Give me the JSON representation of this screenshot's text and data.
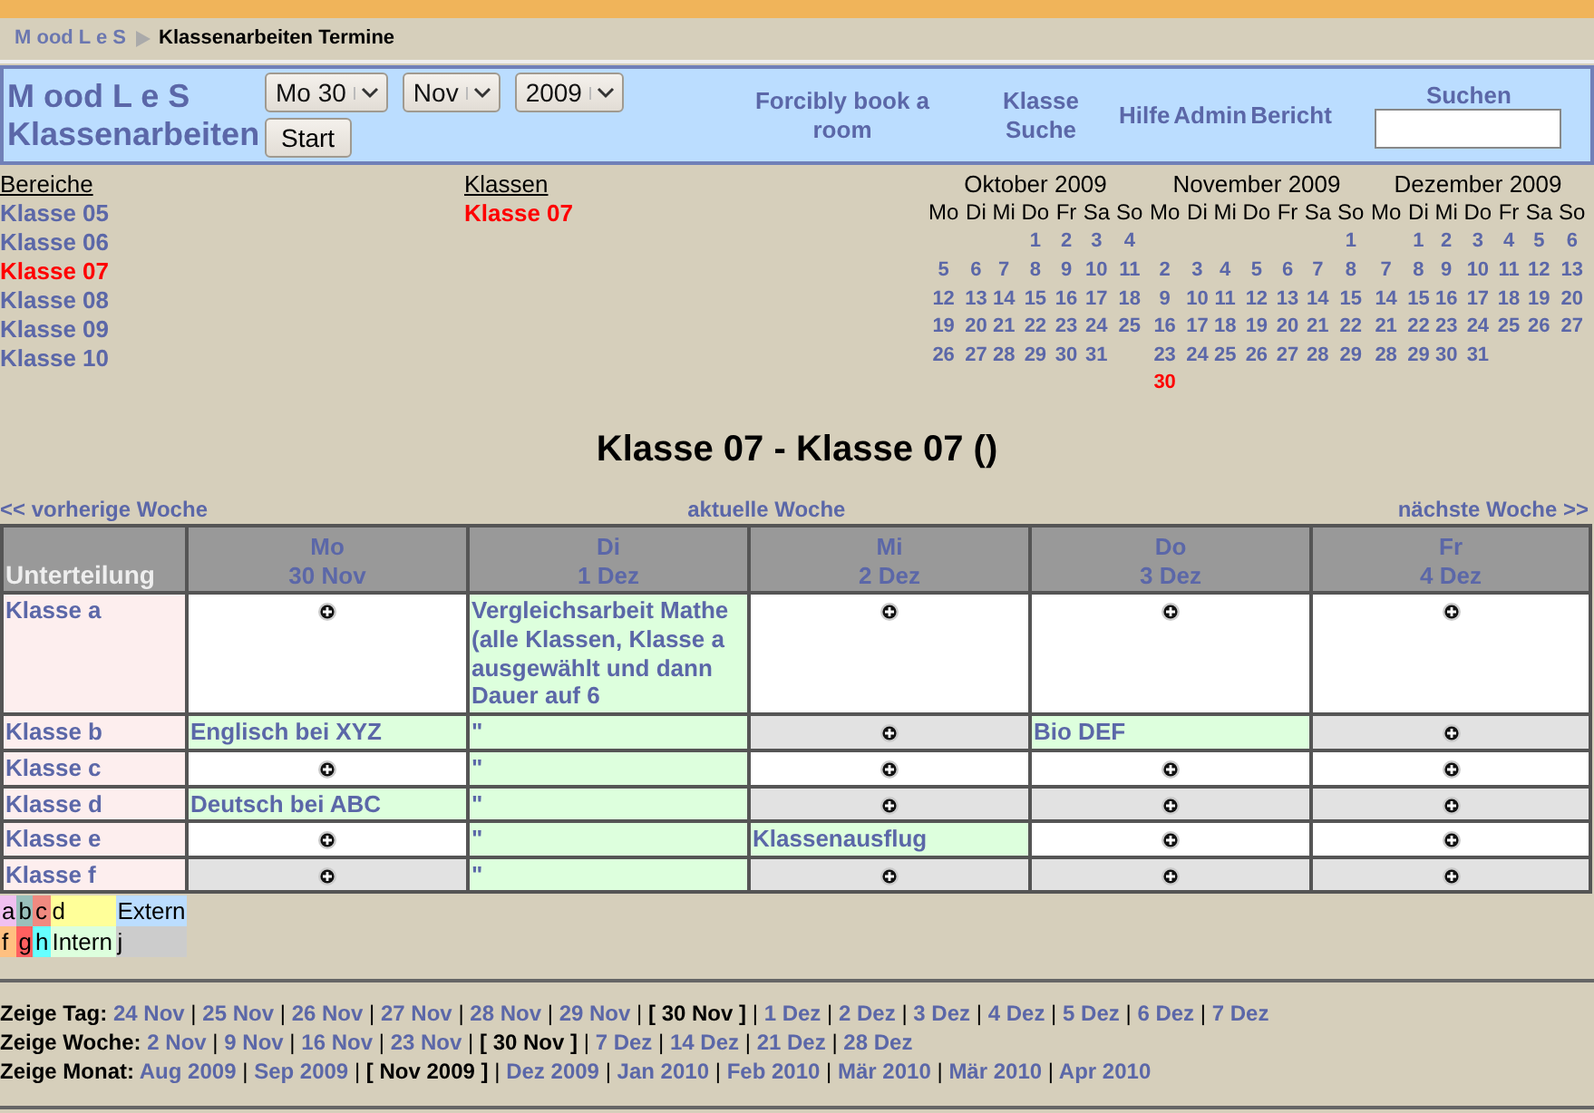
{
  "breadcrumb": {
    "home": "M ood L e S",
    "current": "Klassenarbeiten Termine"
  },
  "header": {
    "title": [
      "M ood L e S",
      "Klassenarbeiten"
    ],
    "selects": [
      "Mo 30",
      "Nov",
      "2009"
    ],
    "start_button": "Start",
    "links": [
      {
        "label": "Forcibly book a room",
        "kind": "wide"
      },
      {
        "label": "Klasse Suche",
        "kind": "wide"
      },
      {
        "label": "Hilfe",
        "kind": "narrow"
      },
      {
        "label": "Admin",
        "kind": "narrow"
      },
      {
        "label": "Bericht",
        "kind": "narrow"
      }
    ],
    "search": {
      "label": "Suchen"
    }
  },
  "bereiche": {
    "heading": "Bereiche",
    "items": [
      {
        "label": "Klasse 05",
        "selected": false
      },
      {
        "label": "Klasse 06",
        "selected": false
      },
      {
        "label": "Klasse 07",
        "selected": true
      },
      {
        "label": "Klasse 08",
        "selected": false
      },
      {
        "label": "Klasse 09",
        "selected": false
      },
      {
        "label": "Klasse 10",
        "selected": false
      }
    ]
  },
  "klassen": {
    "heading": "Klassen",
    "items": [
      {
        "label": "Klasse 07",
        "selected": true
      }
    ]
  },
  "calendars": [
    {
      "title": "Oktober 2009",
      "weekdays": [
        "Mo",
        "Di",
        "Mi",
        "Do",
        "Fr",
        "Sa",
        "So"
      ],
      "weeks": [
        {
          "kind": "opening",
          "days": [
            {
              "d": "1",
              "selected": false
            },
            {
              "d": "2",
              "selected": false
            },
            {
              "d": "3",
              "selected": false
            },
            {
              "d": "4",
              "selected": false
            }
          ]
        },
        {
          "kind": "full",
          "days": [
            {
              "d": "5",
              "selected": false
            },
            {
              "d": "6",
              "selected": false
            },
            {
              "d": "7",
              "selected": false
            },
            {
              "d": "8",
              "selected": false
            },
            {
              "d": "9",
              "selected": false
            },
            {
              "d": "10",
              "selected": false
            },
            {
              "d": "11",
              "selected": false
            }
          ]
        },
        {
          "kind": "full",
          "days": [
            {
              "d": "12",
              "selected": false
            },
            {
              "d": "13",
              "selected": false
            },
            {
              "d": "14",
              "selected": false
            },
            {
              "d": "15",
              "selected": false
            },
            {
              "d": "16",
              "selected": false
            },
            {
              "d": "17",
              "selected": false
            },
            {
              "d": "18",
              "selected": false
            }
          ]
        },
        {
          "kind": "full",
          "days": [
            {
              "d": "19",
              "selected": false
            },
            {
              "d": "20",
              "selected": false
            },
            {
              "d": "21",
              "selected": false
            },
            {
              "d": "22",
              "selected": false
            },
            {
              "d": "23",
              "selected": false
            },
            {
              "d": "24",
              "selected": false
            },
            {
              "d": "25",
              "selected": false
            }
          ]
        },
        {
          "kind": "closing",
          "days": [
            {
              "d": "26",
              "selected": false
            },
            {
              "d": "27",
              "selected": false
            },
            {
              "d": "28",
              "selected": false
            },
            {
              "d": "29",
              "selected": false
            },
            {
              "d": "30",
              "selected": false
            },
            {
              "d": "31",
              "selected": false
            }
          ]
        }
      ]
    },
    {
      "title": "November 2009",
      "weekdays": [
        "Mo",
        "Di",
        "Mi",
        "Do",
        "Fr",
        "Sa",
        "So"
      ],
      "weeks": [
        {
          "kind": "opening",
          "days": [
            {
              "d": "1",
              "selected": false
            }
          ]
        },
        {
          "kind": "full",
          "days": [
            {
              "d": "2",
              "selected": false
            },
            {
              "d": "3",
              "selected": false
            },
            {
              "d": "4",
              "selected": false
            },
            {
              "d": "5",
              "selected": false
            },
            {
              "d": "6",
              "selected": false
            },
            {
              "d": "7",
              "selected": false
            },
            {
              "d": "8",
              "selected": false
            }
          ]
        },
        {
          "kind": "full",
          "days": [
            {
              "d": "9",
              "selected": false
            },
            {
              "d": "10",
              "selected": false
            },
            {
              "d": "11",
              "selected": false
            },
            {
              "d": "12",
              "selected": false
            },
            {
              "d": "13",
              "selected": false
            },
            {
              "d": "14",
              "selected": false
            },
            {
              "d": "15",
              "selected": false
            }
          ]
        },
        {
          "kind": "full",
          "days": [
            {
              "d": "16",
              "selected": false
            },
            {
              "d": "17",
              "selected": false
            },
            {
              "d": "18",
              "selected": false
            },
            {
              "d": "19",
              "selected": false
            },
            {
              "d": "20",
              "selected": false
            },
            {
              "d": "21",
              "selected": false
            },
            {
              "d": "22",
              "selected": false
            }
          ]
        },
        {
          "kind": "full",
          "days": [
            {
              "d": "23",
              "selected": false
            },
            {
              "d": "24",
              "selected": false
            },
            {
              "d": "25",
              "selected": false
            },
            {
              "d": "26",
              "selected": false
            },
            {
              "d": "27",
              "selected": false
            },
            {
              "d": "28",
              "selected": false
            },
            {
              "d": "29",
              "selected": false
            }
          ]
        },
        {
          "kind": "closing",
          "days": [
            {
              "d": "30",
              "selected": true
            }
          ]
        }
      ]
    },
    {
      "title": "Dezember 2009",
      "weekdays": [
        "Mo",
        "Di",
        "Mi",
        "Do",
        "Fr",
        "Sa",
        "So"
      ],
      "weeks": [
        {
          "kind": "opening",
          "days": [
            {
              "d": "1",
              "selected": false
            },
            {
              "d": "2",
              "selected": false
            },
            {
              "d": "3",
              "selected": false
            },
            {
              "d": "4",
              "selected": false
            },
            {
              "d": "5",
              "selected": false
            },
            {
              "d": "6",
              "selected": false
            }
          ]
        },
        {
          "kind": "full",
          "days": [
            {
              "d": "7",
              "selected": false
            },
            {
              "d": "8",
              "selected": false
            },
            {
              "d": "9",
              "selected": false
            },
            {
              "d": "10",
              "selected": false
            },
            {
              "d": "11",
              "selected": false
            },
            {
              "d": "12",
              "selected": false
            },
            {
              "d": "13",
              "selected": false
            }
          ]
        },
        {
          "kind": "full",
          "days": [
            {
              "d": "14",
              "selected": false
            },
            {
              "d": "15",
              "selected": false
            },
            {
              "d": "16",
              "selected": false
            },
            {
              "d": "17",
              "selected": false
            },
            {
              "d": "18",
              "selected": false
            },
            {
              "d": "19",
              "selected": false
            },
            {
              "d": "20",
              "selected": false
            }
          ]
        },
        {
          "kind": "full",
          "days": [
            {
              "d": "21",
              "selected": false
            },
            {
              "d": "22",
              "selected": false
            },
            {
              "d": "23",
              "selected": false
            },
            {
              "d": "24",
              "selected": false
            },
            {
              "d": "25",
              "selected": false
            },
            {
              "d": "26",
              "selected": false
            },
            {
              "d": "27",
              "selected": false
            }
          ]
        },
        {
          "kind": "closing",
          "days": [
            {
              "d": "28",
              "selected": false
            },
            {
              "d": "29",
              "selected": false
            },
            {
              "d": "30",
              "selected": false
            },
            {
              "d": "31",
              "selected": false
            }
          ]
        }
      ]
    }
  ],
  "page_title": "Klasse 07 - Klasse 07 ()",
  "week_nav": {
    "previous": "<< vorherige Woche",
    "current": "aktuelle Woche",
    "next": "nächste Woche >>"
  },
  "table": {
    "corner": "Unterteilung",
    "columns": [
      {
        "day": "Mo",
        "date": "30 Nov"
      },
      {
        "day": "Di",
        "date": "1 Dez"
      },
      {
        "day": "Mi",
        "date": "2 Dez"
      },
      {
        "day": "Do",
        "date": "3 Dez"
      },
      {
        "day": "Fr",
        "date": "4 Dez"
      }
    ],
    "rows": [
      {
        "label": "Klasse a",
        "shaded": false,
        "cells": [
          {
            "kind": "add"
          },
          {
            "kind": "entry",
            "text": "Vergleichsarbeit Mathe (alle Klassen, Klasse a ausgewählt und dann Dauer auf 6"
          },
          {
            "kind": "add"
          },
          {
            "kind": "add"
          },
          {
            "kind": "add"
          }
        ]
      },
      {
        "label": "Klasse b",
        "shaded": true,
        "cells": [
          {
            "kind": "entry",
            "text": "Englisch bei XYZ"
          },
          {
            "kind": "entry",
            "text": "\""
          },
          {
            "kind": "add"
          },
          {
            "kind": "entry",
            "text": "Bio DEF"
          },
          {
            "kind": "add"
          }
        ]
      },
      {
        "label": "Klasse c",
        "shaded": false,
        "cells": [
          {
            "kind": "add"
          },
          {
            "kind": "entry",
            "text": "\""
          },
          {
            "kind": "add"
          },
          {
            "kind": "add"
          },
          {
            "kind": "add"
          }
        ]
      },
      {
        "label": "Klasse d",
        "shaded": true,
        "cells": [
          {
            "kind": "entry",
            "text": "Deutsch bei ABC"
          },
          {
            "kind": "entry",
            "text": "\""
          },
          {
            "kind": "add"
          },
          {
            "kind": "add"
          },
          {
            "kind": "add"
          }
        ]
      },
      {
        "label": "Klasse e",
        "shaded": false,
        "cells": [
          {
            "kind": "add"
          },
          {
            "kind": "entry",
            "text": "\""
          },
          {
            "kind": "entry",
            "text": "Klassenausflug"
          },
          {
            "kind": "add"
          },
          {
            "kind": "add"
          }
        ]
      },
      {
        "label": "Klasse f",
        "shaded": true,
        "cells": [
          {
            "kind": "add"
          },
          {
            "kind": "entry",
            "text": "\""
          },
          {
            "kind": "add"
          },
          {
            "kind": "add"
          },
          {
            "kind": "add"
          }
        ]
      }
    ]
  },
  "legend": [
    [
      {
        "label": "a",
        "color": "#f0c0f0"
      },
      {
        "label": "b",
        "color": "#99c0bb"
      },
      {
        "label": "c",
        "color": "#f08a80"
      },
      {
        "label": "d",
        "color": "#ffff99"
      },
      {
        "label": "Extern",
        "color": "#bbddff"
      }
    ],
    [
      {
        "label": "f",
        "color": "#ffc080"
      },
      {
        "label": "g",
        "color": "#ff6060"
      },
      {
        "label": "h",
        "color": "#66ffff"
      },
      {
        "label": "Intern",
        "color": "#ddffdd"
      },
      {
        "label": "j",
        "color": "#cccccc"
      }
    ]
  ],
  "footer": [
    {
      "label": "Zeige Tag:",
      "separator": "|",
      "links": [
        {
          "label": "24 Nov",
          "selected": false
        },
        {
          "label": "25 Nov",
          "selected": false
        },
        {
          "label": "26 Nov",
          "selected": false
        },
        {
          "label": "27 Nov",
          "selected": false
        },
        {
          "label": "28 Nov",
          "selected": false
        },
        {
          "label": "29 Nov",
          "selected": false
        },
        {
          "label": "[ 30 Nov ]",
          "selected": true
        },
        {
          "label": "1 Dez",
          "selected": false
        },
        {
          "label": "2 Dez",
          "selected": false
        },
        {
          "label": "3 Dez",
          "selected": false
        },
        {
          "label": "4 Dez",
          "selected": false
        },
        {
          "label": "5 Dez",
          "selected": false
        },
        {
          "label": "6 Dez",
          "selected": false
        },
        {
          "label": "7 Dez",
          "selected": false
        }
      ]
    },
    {
      "label": "Zeige Woche:",
      "separator": "|",
      "links": [
        {
          "label": "2 Nov",
          "selected": false
        },
        {
          "label": "9 Nov",
          "selected": false
        },
        {
          "label": "16 Nov",
          "selected": false
        },
        {
          "label": "23 Nov",
          "selected": false
        },
        {
          "label": "[ 30 Nov ]",
          "selected": true
        },
        {
          "label": "7 Dez",
          "selected": false
        },
        {
          "label": "14 Dez",
          "selected": false
        },
        {
          "label": "21 Dez",
          "selected": false
        },
        {
          "label": "28 Dez",
          "selected": false
        }
      ]
    },
    {
      "label": "Zeige Monat:",
      "separator": "|",
      "links": [
        {
          "label": "Aug 2009",
          "selected": false
        },
        {
          "label": "Sep 2009",
          "selected": false
        },
        {
          "label": "[ Nov 2009 ]",
          "selected": true
        },
        {
          "label": "Dez 2009",
          "selected": false
        },
        {
          "label": "Jan 2010",
          "selected": false
        },
        {
          "label": "Feb 2010",
          "selected": false
        },
        {
          "label": "Mär 2010",
          "selected": false
        },
        {
          "label": "Mär 2010",
          "selected": false
        },
        {
          "label": "Apr 2010",
          "selected": false
        }
      ]
    }
  ]
}
